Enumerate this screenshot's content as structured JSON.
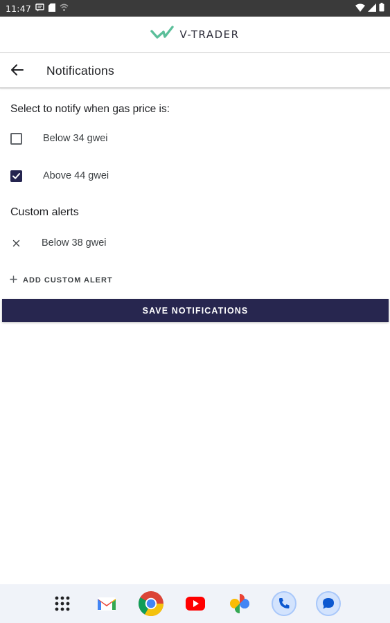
{
  "status_bar": {
    "time": "11:47",
    "left_icons": [
      "message-icon",
      "sd-card-icon",
      "vpn-icon"
    ],
    "right_icons": [
      "wifi-icon",
      "signal-icon",
      "battery-icon"
    ]
  },
  "app": {
    "logo_text": "V-TRADER",
    "brand_color": "#27264f",
    "logo_accent": "#5bbf9a"
  },
  "header": {
    "back_icon": "arrow-left-icon",
    "title": "Notifications"
  },
  "gas": {
    "prompt": "Select to notify when gas price is:",
    "options": [
      {
        "label": "Below 34 gwei",
        "checked": false
      },
      {
        "label": "Above 44 gwei",
        "checked": true
      }
    ]
  },
  "custom": {
    "title": "Custom alerts",
    "alerts": [
      {
        "label": "Below 38 gwei",
        "remove_icon": "close-icon"
      }
    ],
    "add_icon": "plus-icon",
    "add_label": "ADD CUSTOM ALERT"
  },
  "save_label": "SAVE NOTIFICATIONS",
  "dock": {
    "apps": [
      "app-drawer-icon",
      "gmail-icon",
      "chrome-icon",
      "youtube-icon",
      "photos-icon",
      "phone-icon",
      "messages-icon"
    ]
  }
}
